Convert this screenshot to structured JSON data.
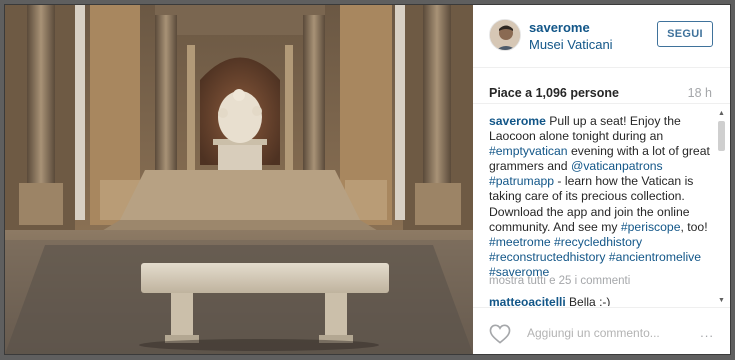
{
  "post": {
    "photo_alt": "Vatican museum courtyard with Laocoon statue and marble bench",
    "author": {
      "username": "saverome",
      "location": "Musei Vaticani"
    },
    "follow_label": "SEGUI",
    "likes_text": "Piace a 1,096 persone",
    "time_ago": "18 h",
    "caption": {
      "username": "saverome",
      "segments": [
        {
          "text": " Pull up a seat! Enjoy the Laocoon alone tonight during an ",
          "tag": false
        },
        {
          "text": "#emptyvatican",
          "tag": true
        },
        {
          "text": " evening with a lot of great grammers and ",
          "tag": false
        },
        {
          "text": "@vaticanpatrons",
          "tag": true
        },
        {
          "text": " ",
          "tag": false
        },
        {
          "text": "#patrumapp",
          "tag": true
        },
        {
          "text": " - learn how the Vatican is taking care of its precious collection. Download the app and join the online community. And see my ",
          "tag": false
        },
        {
          "text": "#periscope",
          "tag": true
        },
        {
          "text": ", too! ",
          "tag": false
        },
        {
          "text": "#meetrome",
          "tag": true
        },
        {
          "text": " ",
          "tag": false
        },
        {
          "text": "#recycledhistory",
          "tag": true
        },
        {
          "text": " ",
          "tag": false
        },
        {
          "text": "#reconstructedhistory",
          "tag": true
        },
        {
          "text": " ",
          "tag": false
        },
        {
          "text": "#ancientromelive",
          "tag": true
        },
        {
          "text": " ",
          "tag": false
        },
        {
          "text": "#saverome",
          "tag": true
        }
      ]
    },
    "show_all_comments": "mostra tutti e 25 i commenti",
    "comments": [
      {
        "username": "matteoacitelli",
        "text": "Bella :-)"
      }
    ],
    "comment_placeholder": "Aggiungi un commento...",
    "more_options": "...",
    "icons": {
      "like": "heart-icon",
      "more": "more-options-icon",
      "scroll_up": "scroll-up-arrow-icon",
      "scroll_down": "scroll-down-arrow-icon"
    },
    "colors": {
      "link": "#125688",
      "follow_border": "#3f729b",
      "muted": "#a5a7aa"
    }
  }
}
